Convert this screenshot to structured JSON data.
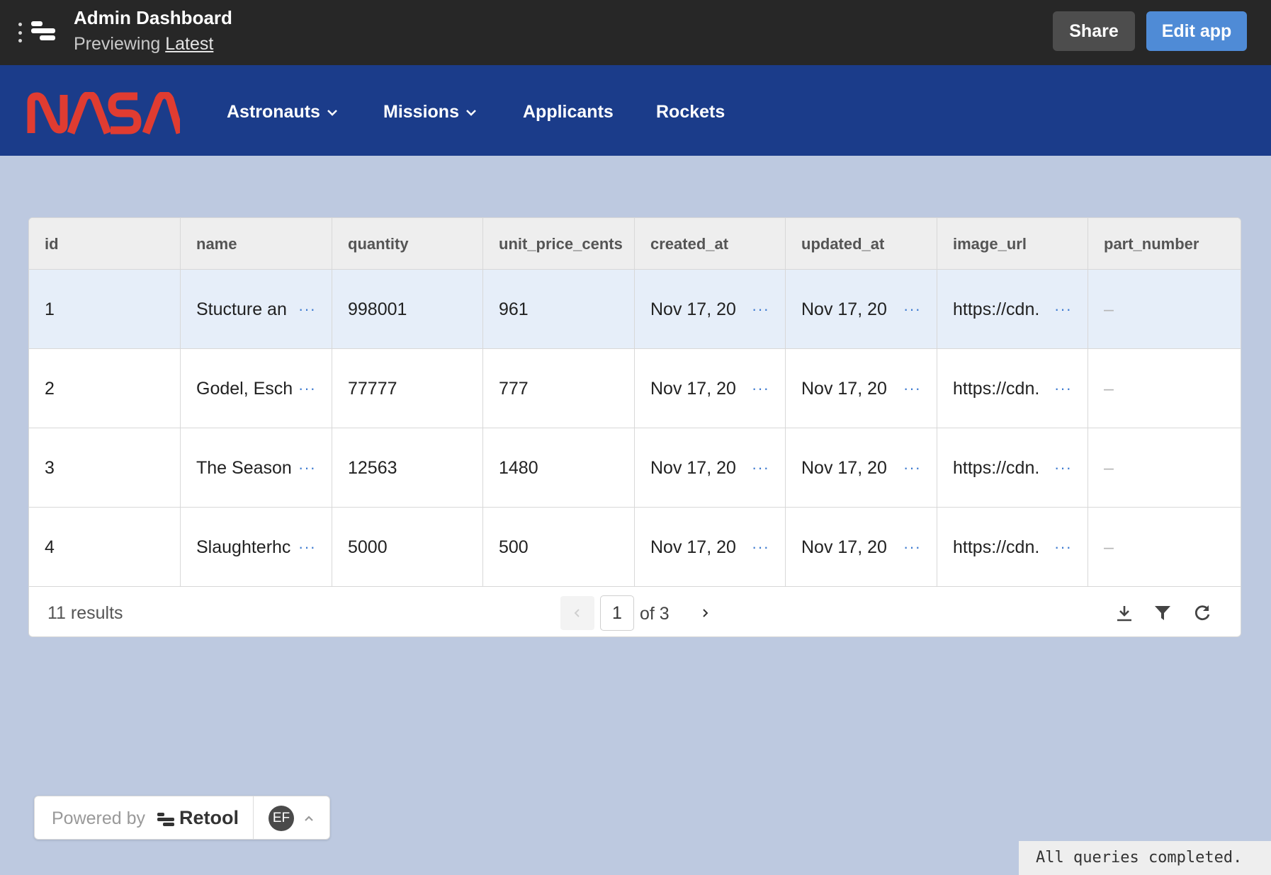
{
  "topbar": {
    "title": "Admin Dashboard",
    "subtitle_prefix": "Previewing ",
    "subtitle_link": "Latest",
    "share_label": "Share",
    "edit_label": "Edit app"
  },
  "nav": {
    "logo_text": "NASA",
    "items": [
      {
        "label": "Astronauts",
        "has_dropdown": true
      },
      {
        "label": "Missions",
        "has_dropdown": true
      },
      {
        "label": "Applicants",
        "has_dropdown": false
      },
      {
        "label": "Rockets",
        "has_dropdown": false
      }
    ]
  },
  "table": {
    "columns": [
      "id",
      "name",
      "quantity",
      "unit_price_cents",
      "created_at",
      "updated_at",
      "image_url",
      "part_number"
    ],
    "rows": [
      {
        "id": "1",
        "name": "Stucture an",
        "quantity": "998001",
        "unit_price_cents": "961",
        "created_at": "Nov 17, 20",
        "updated_at": "Nov 17, 20",
        "image_url": "https://cdn.",
        "part_number": "–"
      },
      {
        "id": "2",
        "name": "Godel, Esch",
        "quantity": "77777",
        "unit_price_cents": "777",
        "created_at": "Nov 17, 20",
        "updated_at": "Nov 17, 20",
        "image_url": "https://cdn.",
        "part_number": "–"
      },
      {
        "id": "3",
        "name": "The Season",
        "quantity": "12563",
        "unit_price_cents": "1480",
        "created_at": "Nov 17, 20",
        "updated_at": "Nov 17, 20",
        "image_url": "https://cdn.",
        "part_number": "–"
      },
      {
        "id": "4",
        "name": "Slaughterhc",
        "quantity": "5000",
        "unit_price_cents": "500",
        "created_at": "Nov 17, 20",
        "updated_at": "Nov 17, 20",
        "image_url": "https://cdn.",
        "part_number": "–"
      }
    ],
    "more_glyph": "···",
    "results_text": "11 results",
    "page_current": "1",
    "page_of_text": "of 3"
  },
  "powered": {
    "prefix": "Powered by",
    "brand": "Retool",
    "avatar_initials": "EF"
  },
  "status_text": "All queries completed.",
  "colors": {
    "topbar_bg": "#272727",
    "nav_bg": "#1b3c8a",
    "nasa_red": "#e03c31",
    "page_bg": "#bdc9e0",
    "edit_button": "#4f8bd6",
    "selected_row": "#e6eef9",
    "link_blue": "#3e7bd0"
  }
}
